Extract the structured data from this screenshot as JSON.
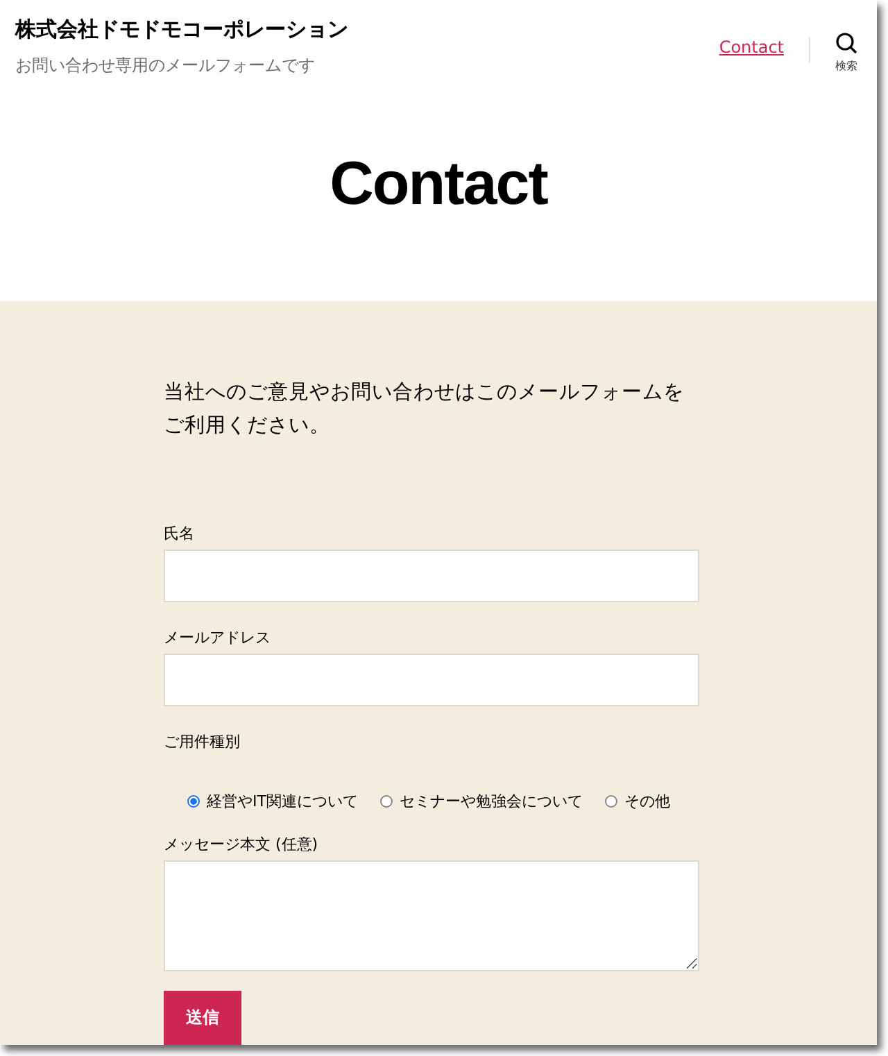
{
  "header": {
    "site_title": "株式会社ドモドモコーポレーション",
    "tagline": "お問い合わせ専用のメールフォームです",
    "nav": [
      {
        "label": "Contact"
      }
    ],
    "search_label": "検索"
  },
  "page_title": "Contact",
  "intro": "当社へのご意見やお問い合わせはこのメールフォームをご利用ください。",
  "form": {
    "fields": [
      {
        "kind": "text",
        "label": "氏名"
      },
      {
        "kind": "text",
        "label": "メールアドレス"
      },
      {
        "kind": "radio",
        "label": "ご用件種別",
        "options": [
          {
            "label": "経営やIT関連について",
            "selected": true
          },
          {
            "label": "セミナーや勉強会について",
            "selected": false
          },
          {
            "label": "その他",
            "selected": false
          }
        ]
      },
      {
        "kind": "textarea",
        "label": "メッセージ本文 (任意)"
      }
    ],
    "submit": "送信"
  }
}
